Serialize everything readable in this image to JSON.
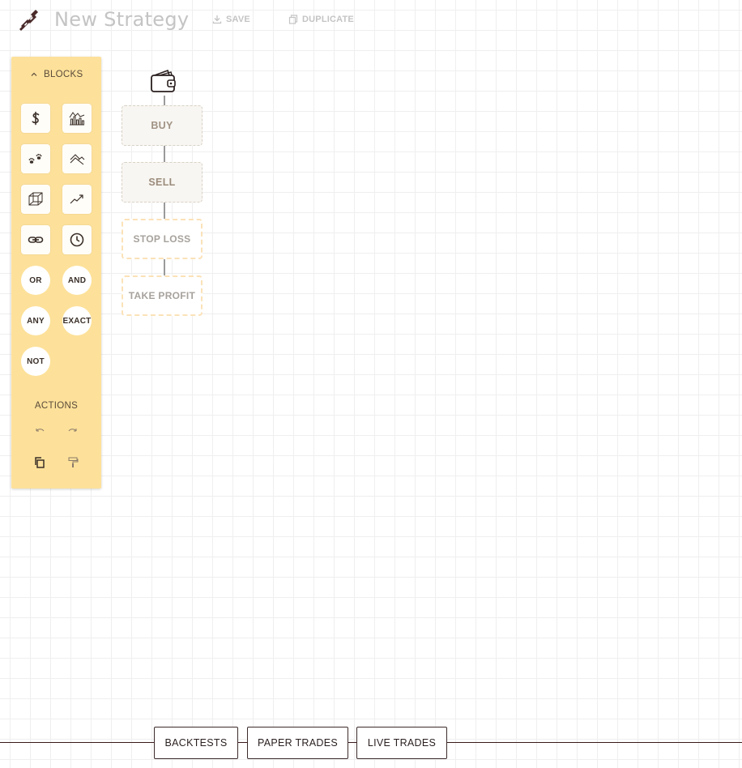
{
  "header": {
    "title": "New Strategy",
    "save_label": "SAVE",
    "duplicate_label": "DUPLICATE",
    "logo_icon": "chain-link-icon"
  },
  "panel": {
    "blocks_heading": "BLOCKS",
    "actions_heading": "ACTIONS",
    "bg_color": "#fde19a",
    "icon_blocks": [
      "dollar-icon",
      "chart-bars-icon",
      "paw-prints-icon",
      "crossover-icon",
      "cube-icon",
      "trending-up-icon",
      "link-icon",
      "clock-icon"
    ],
    "logic_blocks": [
      "OR",
      "AND",
      "ANY",
      "EXACT",
      "NOT"
    ],
    "actions": [
      "undo-icon",
      "redo-icon",
      "copy-icon",
      "paint-roller-icon"
    ]
  },
  "canvas": {
    "root_icon": "wallet-icon",
    "nodes": [
      {
        "label": "BUY",
        "style": "solid"
      },
      {
        "label": "SELL",
        "style": "solid"
      },
      {
        "label": "STOP LOSS",
        "style": "dashed"
      },
      {
        "label": "TAKE PROFIT",
        "style": "dashed"
      }
    ]
  },
  "bottom_tabs": [
    "BACKTESTS",
    "PAPER TRADES",
    "LIVE TRADES"
  ]
}
